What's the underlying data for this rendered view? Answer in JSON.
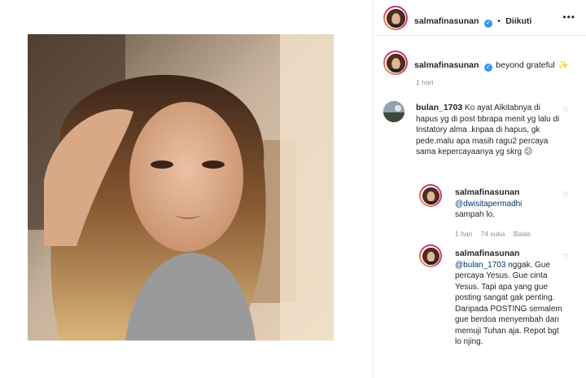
{
  "header": {
    "username": "salmafinasunan",
    "separator": "•",
    "follow_status": "Diikuti",
    "more": "•••"
  },
  "caption": {
    "username": "salmafinasunan",
    "text": "beyond grateful",
    "emoji": "✨",
    "time": "1 hari"
  },
  "comments": [
    {
      "username": "bulan_1703",
      "text": "Ko ayat Alkitabnya di hapus yg di post bbrapa menit yg lalu di Instatory alma .knpaa di hapus, gk pede.malu apa masih ragu2 percaya sama kepercayaanya yg skrg",
      "emoji": "😕"
    }
  ],
  "replies": [
    {
      "username": "salmafinasunan",
      "mention": "@dwisitapermadhi",
      "text": "sampah lo.",
      "time": "1 hari",
      "likes": "74 suka",
      "reply_label": "Balas"
    },
    {
      "username": "salmafinasunan",
      "mention": "@bulan_1703",
      "text": "nggak. Gue percaya Yesus. Gue cinta Yesus. Tapi apa yang gue posting sangat gak penting. Daripada POSTING semalem gue berdoa menyembah dan memuji Tuhan aja. Repot bgt lo njing."
    }
  ],
  "icons": {
    "heart": "♡",
    "verified": "✓"
  },
  "colors": {
    "verified_blue": "#3897f0",
    "story_ring": "#e1306c",
    "meta_gray": "#8e8e8e"
  }
}
